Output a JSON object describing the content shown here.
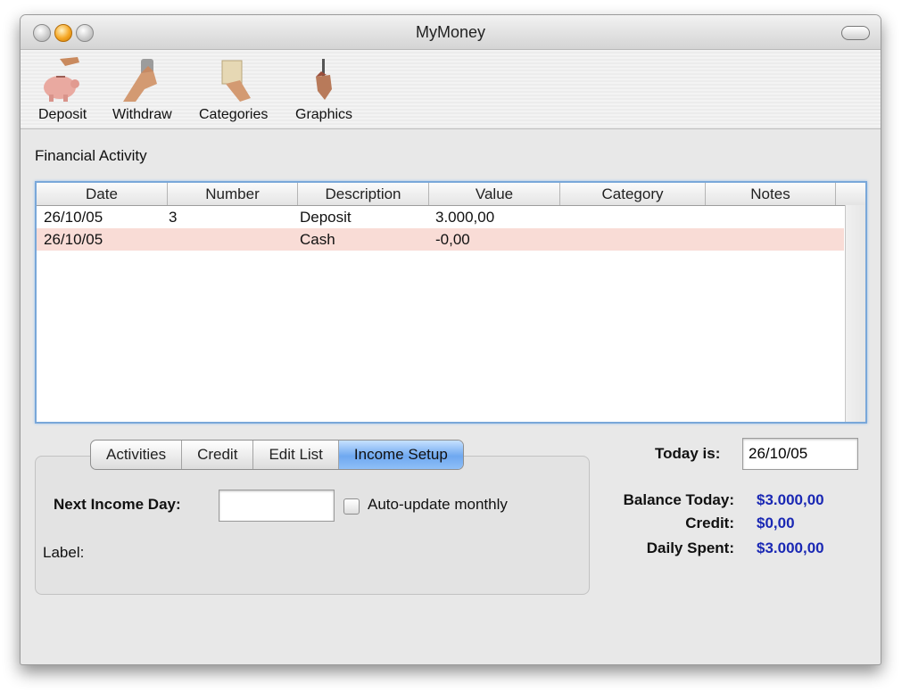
{
  "window": {
    "title": "MyMoney"
  },
  "toolbar": {
    "items": [
      {
        "label": "Deposit",
        "icon": "piggy-bank-icon"
      },
      {
        "label": "Withdraw",
        "icon": "hand-withdraw-icon"
      },
      {
        "label": "Categories",
        "icon": "notebook-hand-icon"
      },
      {
        "label": "Graphics",
        "icon": "pen-hand-icon"
      }
    ]
  },
  "activity": {
    "label": "Financial Activity",
    "columns": [
      "Date",
      "Number",
      "Description",
      "Value",
      "Category",
      "Notes"
    ],
    "rows": [
      {
        "date": "26/10/05",
        "number": "3",
        "description": "Deposit",
        "value": "3.000,00",
        "category": "",
        "notes": ""
      },
      {
        "date": "26/10/05",
        "number": "",
        "description": "Cash",
        "value": "-0,00",
        "category": "",
        "notes": ""
      }
    ]
  },
  "tabs": {
    "items": [
      "Activities",
      "Credit",
      "Edit List",
      "Income Setup"
    ],
    "active": "Income Setup"
  },
  "income_setup": {
    "next_income_day_label": "Next Income Day:",
    "next_income_day_value": "",
    "auto_update_label": "Auto-update monthly",
    "auto_update_checked": false,
    "label_label": "Label:"
  },
  "summary": {
    "today_label": "Today is:",
    "today_value": "26/10/05",
    "balance_today_label": "Balance Today:",
    "balance_today_value": "$3.000,00",
    "credit_label": "Credit:",
    "credit_value": "$0,00",
    "daily_spent_label": "Daily Spent:",
    "daily_spent_value": "$3.000,00",
    "value_color": "#1a28b4"
  },
  "colors": {
    "selected_row": "#f9dcd6",
    "active_tab": "#6fa8f0",
    "table_focus_border": "#79a7d9"
  }
}
